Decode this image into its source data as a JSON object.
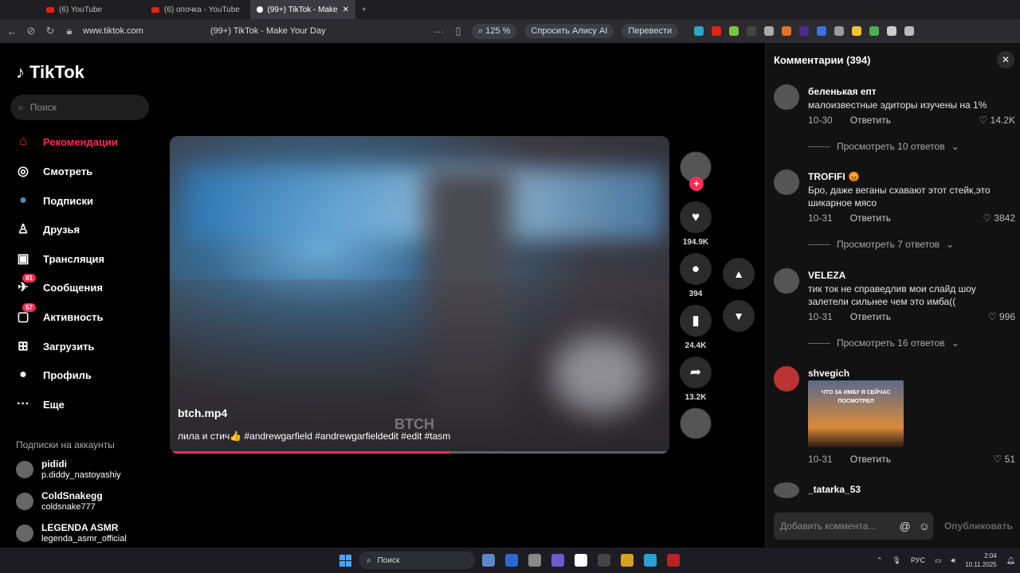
{
  "browser": {
    "tabs": [
      {
        "label": "(6) YouTube",
        "kind": "youtube"
      },
      {
        "label": "(6) опочка - YouTube",
        "kind": "youtube"
      },
      {
        "label": "(99+) TikTok - Make",
        "kind": "tiktok"
      }
    ],
    "url": "www.tiktok.com",
    "page_title": "(99+) TikTok - Make Your Day",
    "zoom": "125 %",
    "ask_alice": "Спросить Алису AI",
    "translate": "Перевести"
  },
  "sidebar": {
    "logo": "TikTok",
    "search_placeholder": "Поиск",
    "nav": [
      {
        "label": "Рекомендации",
        "icon": "home-icon",
        "glyph": "⌂"
      },
      {
        "label": "Смотреть",
        "icon": "compass-icon",
        "glyph": "◎"
      },
      {
        "label": "Подписки",
        "icon": "following-avatar-icon",
        "glyph": "●"
      },
      {
        "label": "Друзья",
        "icon": "friends-icon",
        "glyph": "♙"
      },
      {
        "label": "Трансляция",
        "icon": "live-tv-icon",
        "glyph": "▣"
      },
      {
        "label": "Сообщения",
        "icon": "messages-icon",
        "glyph": "✈",
        "badge": "81"
      },
      {
        "label": "Активность",
        "icon": "activity-icon",
        "glyph": "▢",
        "badge": "57"
      },
      {
        "label": "Загрузить",
        "icon": "upload-icon",
        "glyph": "⊞"
      },
      {
        "label": "Профиль",
        "icon": "profile-avatar-icon",
        "glyph": "●"
      },
      {
        "label": "Еще",
        "icon": "more-icon",
        "glyph": "···"
      }
    ],
    "subs_title": "Подписки на аккаунты",
    "subs": [
      {
        "name": "pididi",
        "handle": "p.diddy_nastoyashiy"
      },
      {
        "name": "ColdSnakegg",
        "handle": "coldsnake777"
      },
      {
        "name": "LEGENDA ASMR",
        "handle": "legenda_asmr_official"
      }
    ]
  },
  "video": {
    "title": "btch.mp4",
    "description": "лила и стич👍 #andrewgarfield #andrewgarfieldedit #edit #tasm",
    "watermark": "BTCH",
    "progress": 0.56
  },
  "actions": {
    "likes": "194.9K",
    "comments": "394",
    "saves": "24.4K",
    "shares": "13.2K"
  },
  "comments_panel": {
    "header": "Комментарии (394)",
    "items": [
      {
        "user": "беленькая епт",
        "text": "малоизвестные эдиторы изучены на 1%",
        "date": "10-30",
        "reply": "Ответить",
        "likes": "14.2K",
        "replies": "Просмотреть 10 ответов"
      },
      {
        "user": "TROFIFI 😡",
        "text": "Бро, даже веганы схавают этот стейк,это шикарное мясо",
        "date": "10-31",
        "reply": "Ответить",
        "likes": "3842",
        "replies": "Просмотреть 7 ответов"
      },
      {
        "user": "VELEZA",
        "text": "тик ток не справедлив мои слайд шоу залетели сильнее чем это имба((",
        "date": "10-31",
        "reply": "Ответить",
        "likes": "996",
        "replies": "Просмотреть 16 ответов"
      },
      {
        "user": "shvegich",
        "text": "",
        "thumb_text": "ЧТО ЗА ИМБУ Я СЕЙЧАС ПОСМОТРЕЛ",
        "date": "10-31",
        "reply": "Ответить",
        "likes": "51"
      },
      {
        "user": "_tatarka_53"
      }
    ],
    "input_placeholder": "Добавить коммента...",
    "post_label": "Опубликовать"
  },
  "taskbar": {
    "search": "Поиск",
    "lang": "РУС",
    "time": "2:04",
    "date": "10.11.2025"
  },
  "colors": {
    "accent": "#fe2c55"
  }
}
